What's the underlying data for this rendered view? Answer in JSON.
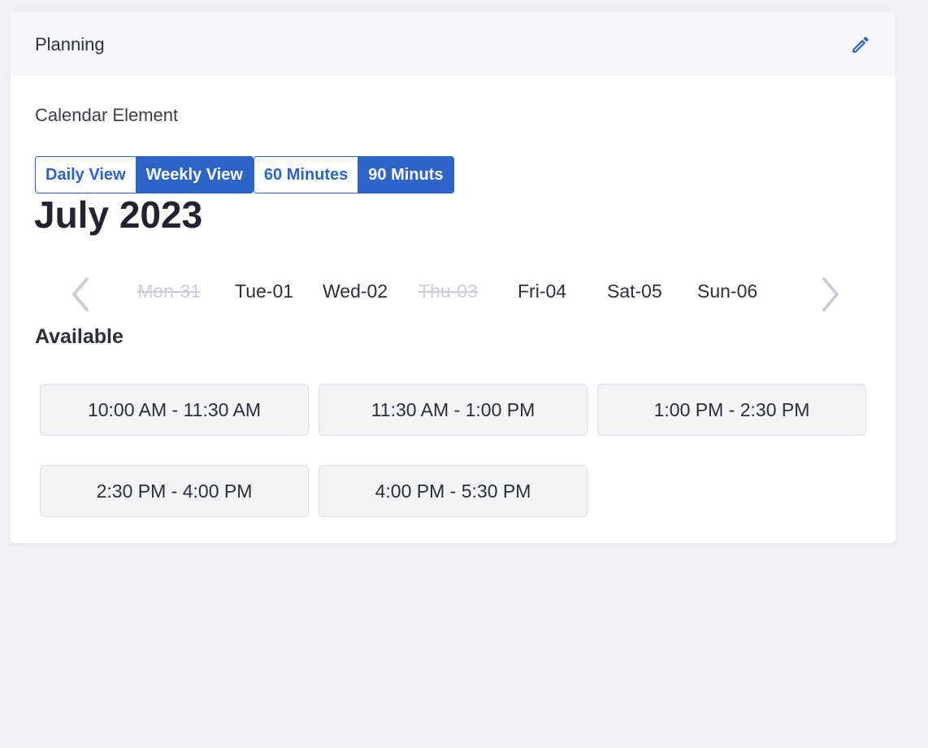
{
  "header": {
    "title": "Planning",
    "edit_icon": "pencil-icon"
  },
  "element_label": "Calendar Element",
  "view_toggle": [
    {
      "label": "Daily View",
      "active": false
    },
    {
      "label": "Weekly View",
      "active": true
    }
  ],
  "duration_toggle": [
    {
      "label": "60 Minutes",
      "active": false
    },
    {
      "label": "90 Minuts",
      "active": true
    }
  ],
  "month_title": "July 2023",
  "week": {
    "prev_icon": "chevron-left-icon",
    "next_icon": "chevron-right-icon",
    "days": [
      {
        "label": "Mon-31",
        "disabled": true
      },
      {
        "label": "Tue-01",
        "disabled": false
      },
      {
        "label": "Wed-02",
        "disabled": false
      },
      {
        "label": "Thu-03",
        "disabled": true
      },
      {
        "label": "Fri-04",
        "disabled": false
      },
      {
        "label": "Sat-05",
        "disabled": false
      },
      {
        "label": "Sun-06",
        "disabled": false
      }
    ]
  },
  "available_label": "Available",
  "slots": [
    "10:00 AM - 11:30 AM",
    "11:30 AM - 1:00 PM",
    "1:00 PM - 2:30 PM",
    "2:30 PM - 4:00 PM",
    "4:00 PM - 5:30 PM"
  ],
  "colors": {
    "accent": "#2d64c8",
    "disabled_text": "#c9cfd8",
    "page_background": "#eff0f4",
    "slot_background": "#f2f3f5"
  }
}
